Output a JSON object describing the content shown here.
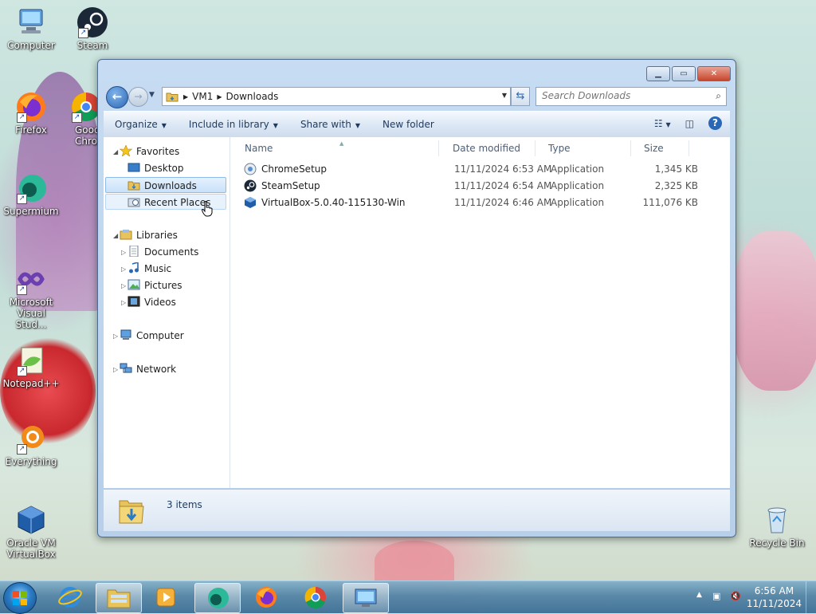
{
  "desktop": {
    "icons": [
      {
        "label": "Computer"
      },
      {
        "label": "Steam"
      },
      {
        "label": "Firefox"
      },
      {
        "label": "Good Chro"
      },
      {
        "label": "Supermium"
      },
      {
        "label": "Microsoft Visual Stud..."
      },
      {
        "label": "Notepad++"
      },
      {
        "label": "Everything"
      },
      {
        "label": "Oracle VM VirtualBox"
      },
      {
        "label": "Recycle Bin"
      }
    ]
  },
  "window": {
    "address": {
      "crumbs": [
        "VM1",
        "Downloads"
      ]
    },
    "search": {
      "placeholder": "Search Downloads"
    },
    "toolbar": {
      "organize": "Organize",
      "include_in_library": "Include in library",
      "share_with": "Share with",
      "new_folder": "New folder"
    },
    "nav": {
      "favorites": "Favorites",
      "desktop": "Desktop",
      "downloads": "Downloads",
      "recent_places": "Recent Places",
      "libraries": "Libraries",
      "documents": "Documents",
      "music": "Music",
      "pictures": "Pictures",
      "videos": "Videos",
      "computer": "Computer",
      "network": "Network"
    },
    "columns": {
      "name": "Name",
      "date": "Date modified",
      "type": "Type",
      "size": "Size"
    },
    "files": [
      {
        "name": "ChromeSetup",
        "date": "11/11/2024 6:53 AM",
        "type": "Application",
        "size": "1,345 KB"
      },
      {
        "name": "SteamSetup",
        "date": "11/11/2024 6:54 AM",
        "type": "Application",
        "size": "2,325 KB"
      },
      {
        "name": "VirtualBox-5.0.40-115130-Win",
        "date": "11/11/2024 6:46 AM",
        "type": "Application",
        "size": "111,076 KB"
      }
    ],
    "details": {
      "count": "3 items"
    }
  },
  "taskbar": {
    "clock_time": "6:56 AM",
    "clock_date": "11/11/2024"
  },
  "colors": {
    "accent": "#2b67b4",
    "selection": "#c9e1fa"
  }
}
